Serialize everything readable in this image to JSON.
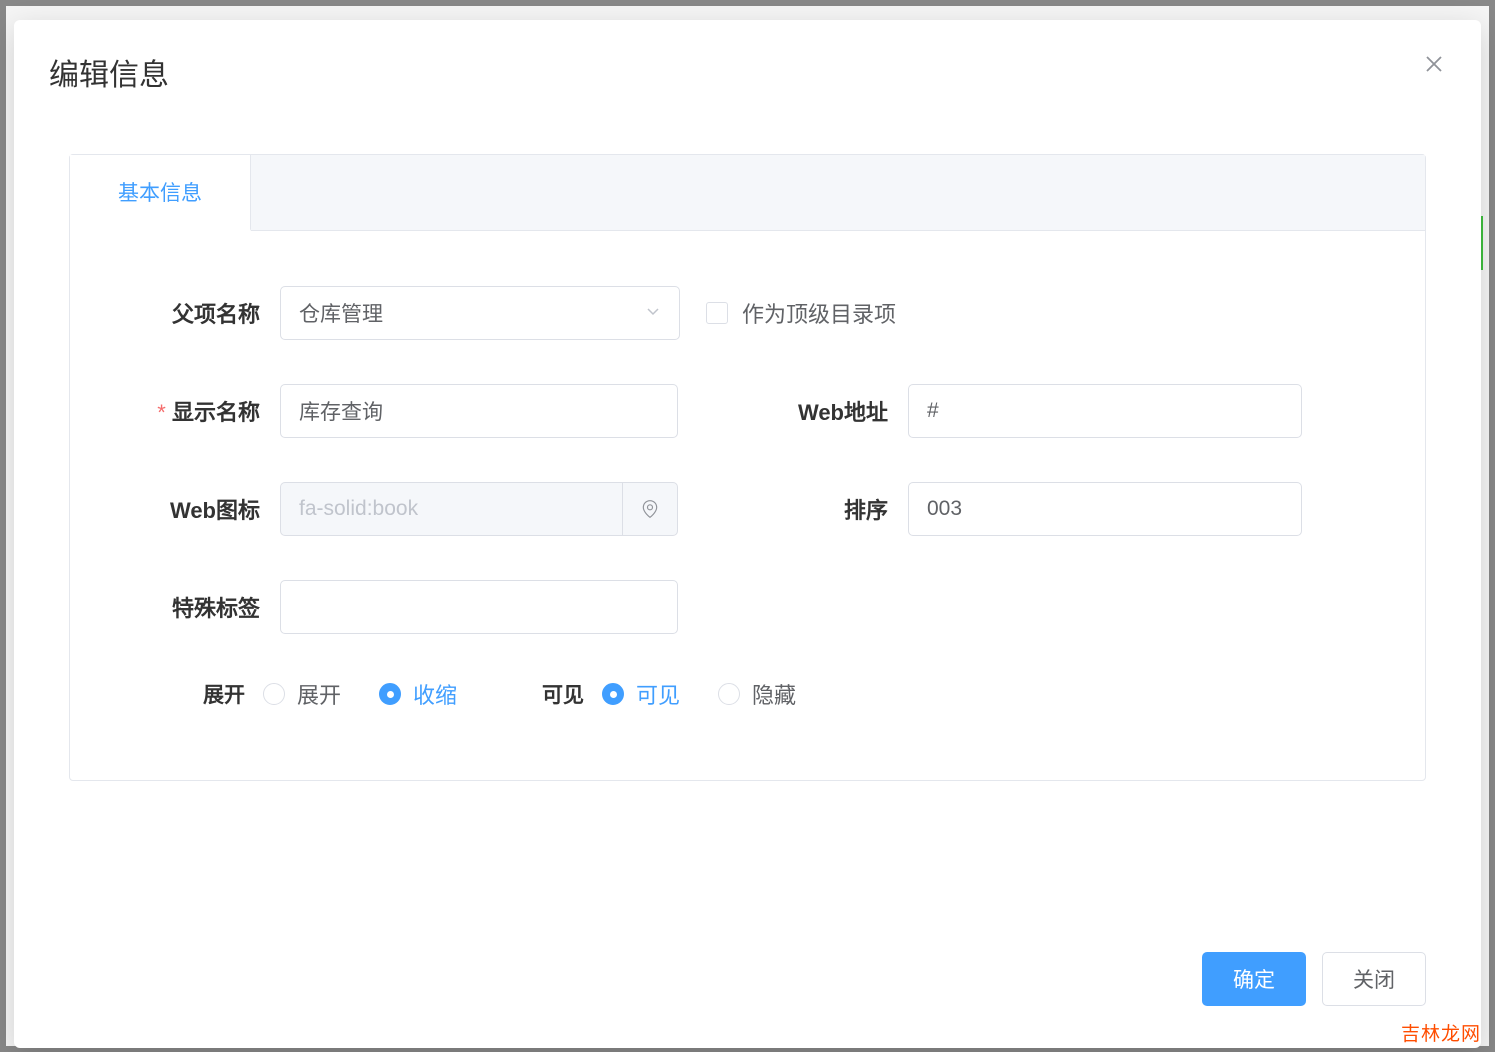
{
  "modal": {
    "title": "编辑信息",
    "tab_label": "基本信息",
    "confirm_label": "确定",
    "close_label": "关闭"
  },
  "form": {
    "parent_label": "父项名称",
    "parent_value": "仓库管理",
    "top_level_label": "作为顶级目录项",
    "display_name_label": "显示名称",
    "display_name_value": "库存查询",
    "web_url_label": "Web地址",
    "web_url_value": "#",
    "web_icon_label": "Web图标",
    "web_icon_placeholder": "fa-solid:book",
    "sort_label": "排序",
    "sort_value": "003",
    "special_tag_label": "特殊标签",
    "special_tag_value": "",
    "expand_label": "展开",
    "expand_opt1": "展开",
    "expand_opt2": "收缩",
    "visible_label": "可见",
    "visible_opt1": "可见",
    "visible_opt2": "隐藏"
  },
  "watermark": "吉林龙网"
}
